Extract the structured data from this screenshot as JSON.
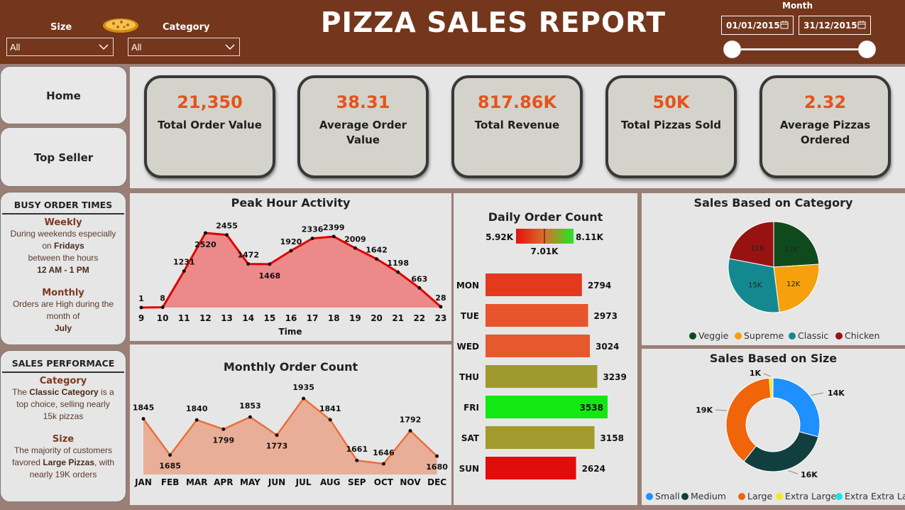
{
  "header": {
    "title": "PIZZA SALES REPORT",
    "size_label": "Size",
    "size_value": "All",
    "category_label": "Category",
    "category_value": "All",
    "month_label": "Month",
    "date_start": "01/01/2015",
    "date_end": "31/12/2015",
    "logo_icon": "pizza-icon"
  },
  "nav": {
    "home": "Home",
    "top_seller": "Top Seller"
  },
  "kpis": [
    {
      "value": "21,350",
      "label": "Total Order Value"
    },
    {
      "value": "38.31",
      "label": "Average Order Value"
    },
    {
      "value": "817.86K",
      "label": "Total Revenue"
    },
    {
      "value": "50K",
      "label": "Total Pizzas Sold"
    },
    {
      "value": "2.32",
      "label": "Average Pizzas Ordered"
    }
  ],
  "busy": {
    "title": "BUSY ORDER TIMES",
    "weekly_title": "Weekly",
    "weekly_l1": "During weekends especially",
    "weekly_l2a": "on ",
    "weekly_l2b": "Fridays",
    "weekly_l3": "between the hours",
    "weekly_l4": "12 AM - 1 PM",
    "monthly_title": "Monthly",
    "monthly_l1": "Orders are High during the",
    "monthly_l2": "month of",
    "monthly_l3": "July"
  },
  "perf": {
    "title": "SALES PERFORMACE",
    "cat_title": "Category",
    "cat_l1a": "The ",
    "cat_l1b": "Classic Category",
    "cat_l1c": " is a",
    "cat_l2": "top choice, selling nearly",
    "cat_l3": "15k pizzas",
    "size_title": "Size",
    "size_l1": "The majority of customers",
    "size_l2a": "favored ",
    "size_l2b": "Large Pizzas",
    "size_l2c": ", with",
    "size_l3": "nearly 19K orders"
  },
  "colors": {
    "header_bg": "#74361c",
    "kpi_value": "#e5531b",
    "peak_line": "#e00000",
    "peak_fill": "#ec8a8a",
    "monthly_line": "#e8703a",
    "monthly_fill": "#e9ae98"
  },
  "chart_data": [
    {
      "type": "area",
      "title": "Peak Hour Activity",
      "xlabel": "Time",
      "ylabel": "",
      "x": [
        9,
        10,
        11,
        12,
        13,
        14,
        15,
        16,
        17,
        18,
        19,
        20,
        21,
        22,
        23
      ],
      "values": [
        1,
        8,
        1231,
        2520,
        2455,
        1472,
        1468,
        1920,
        2336,
        2399,
        2009,
        1642,
        1198,
        663,
        28
      ]
    },
    {
      "type": "area",
      "title": "Monthly Order Count",
      "categories": [
        "JAN",
        "FEB",
        "MAR",
        "APR",
        "MAY",
        "JUN",
        "JUL",
        "AUG",
        "SEP",
        "OCT",
        "NOV",
        "DEC"
      ],
      "values": [
        1845,
        1685,
        1840,
        1799,
        1853,
        1773,
        1935,
        1841,
        1661,
        1646,
        1792,
        1680
      ]
    },
    {
      "type": "bar",
      "title": "Daily Order Count",
      "orientation": "horizontal",
      "legend_min": "5.92K",
      "legend_mid": "7.01K",
      "legend_max": "8.11K",
      "categories": [
        "MON",
        "TUE",
        "WED",
        "THU",
        "FRI",
        "SAT",
        "SUN"
      ],
      "values": [
        2794,
        2973,
        3024,
        3239,
        3538,
        3158,
        2624
      ],
      "colors": [
        "#e33a1e",
        "#e8542c",
        "#e6582e",
        "#a09a2e",
        "#12e812",
        "#a29a2c",
        "#e10d0d"
      ]
    },
    {
      "type": "pie",
      "title": "Sales Based on Category",
      "labels": [
        "Veggie",
        "Supreme",
        "Classic",
        "Chicken"
      ],
      "values": [
        12,
        12,
        15,
        11
      ],
      "value_labels": [
        "12K",
        "12K",
        "15K",
        "11K"
      ],
      "colors": [
        "#0f4a1c",
        "#f5a00c",
        "#13898f",
        "#981212"
      ],
      "legend": "bottom"
    },
    {
      "type": "pie",
      "title": "Sales Based on Size",
      "donut": true,
      "labels": [
        "Small",
        "Medium",
        "Large",
        "Extra Large",
        "Extra Extra Large"
      ],
      "values": [
        14.4,
        15.6,
        18.8,
        0.6,
        0.03
      ],
      "value_labels": [
        "14K",
        "16K",
        "19K",
        "1K",
        ""
      ],
      "colors": [
        "#1e90ff",
        "#113f3f",
        "#f0640a",
        "#f2ec1a",
        "#1ae6e6"
      ],
      "legend": "bottom"
    }
  ]
}
